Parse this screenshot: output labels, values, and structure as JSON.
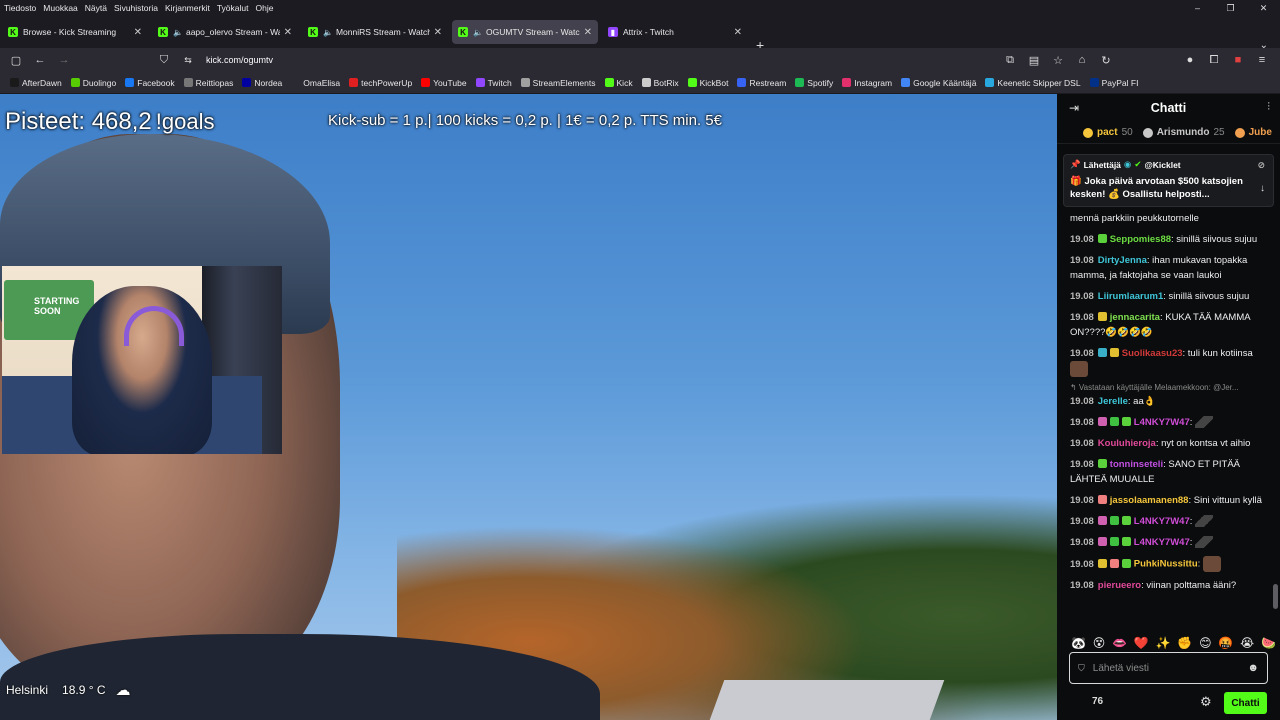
{
  "menubar": {
    "items": [
      "Tiedosto",
      "Muokkaa",
      "Näytä",
      "Sivuhistoria",
      "Kirjanmerkit",
      "Työkalut",
      "Ohje"
    ],
    "window_controls": [
      "–",
      "❐",
      "✕"
    ]
  },
  "tabs": [
    {
      "title": "Browse - Kick Streaming",
      "favicon": "kick",
      "audio": false,
      "active": false
    },
    {
      "title": "aapo_olervo Stream - Watch Live",
      "favicon": "kick",
      "audio": true,
      "active": false
    },
    {
      "title": "MonniRS Stream - Watch Live",
      "favicon": "kick",
      "audio": true,
      "active": false
    },
    {
      "title": "OGUMTV Stream - Watch Live",
      "favicon": "kick",
      "audio": true,
      "active": true
    },
    {
      "title": "Attrix - Twitch",
      "favicon": "twitch",
      "audio": false,
      "active": false
    }
  ],
  "nav": {
    "url": "kick.com/ogumtv",
    "back": "←",
    "forward": "→",
    "sidebar": "▢",
    "shield": "⛉",
    "tune": "⇆"
  },
  "bookmarks": [
    {
      "label": "AfterDawn",
      "color": "#1a1a1a"
    },
    {
      "label": "Duolingo",
      "color": "#58cc02"
    },
    {
      "label": "Facebook",
      "color": "#1877f2"
    },
    {
      "label": "Reittiopas",
      "color": "#777777"
    },
    {
      "label": "Nordea",
      "color": "#0000a0"
    },
    {
      "label": "OmaElisa",
      "color": "#2b2a33"
    },
    {
      "label": "techPowerUp",
      "color": "#e02020"
    },
    {
      "label": "YouTube",
      "color": "#ff0000"
    },
    {
      "label": "Twitch",
      "color": "#9146ff"
    },
    {
      "label": "StreamElements",
      "color": "#a0a0a0"
    },
    {
      "label": "Kick",
      "color": "#53fc18"
    },
    {
      "label": "BotRix",
      "color": "#cccccc"
    },
    {
      "label": "KickBot",
      "color": "#53fc18"
    },
    {
      "label": "Restream",
      "color": "#3763f4"
    },
    {
      "label": "Spotify",
      "color": "#1db954"
    },
    {
      "label": "Instagram",
      "color": "#e1306c"
    },
    {
      "label": "Google Kääntäjä",
      "color": "#4285f4"
    },
    {
      "label": "Keenetic Skipper DSL",
      "color": "#29a8e0"
    },
    {
      "label": "PayPal FI",
      "color": "#003087"
    }
  ],
  "stream": {
    "score_label": "Pisteet: 468,2",
    "goals_cmd": "!goals",
    "rules": "Kick-sub = 1 p.| 100 kicks = 0,2 p. | 1€ = 0,2 p. TTS min. 5€",
    "webcam_poster": "STARTING SOON",
    "weather_city": "Helsinki",
    "weather_temp": "18.9 ° C",
    "weather_icon": "☁"
  },
  "chat": {
    "title": "Chatti",
    "leaderboard": [
      {
        "name": "pact",
        "count": "50",
        "color": "#f5c63c"
      },
      {
        "name": "Arismundo",
        "count": "25",
        "color": "#c8c8c8"
      },
      {
        "name": "Jube",
        "count": "",
        "color": "#f0a050"
      }
    ],
    "pinned": {
      "header": "Lähettäjä",
      "sender": "@Kicklet",
      "text": "🎁 Joka päivä arvotaan $500 katsojien kesken! 💰 Osallistu helposti..."
    },
    "partial_top": "mennä parkkiin peukkutornelle",
    "messages": [
      {
        "ts": "19.08",
        "user": "Seppomies88",
        "color": "#6cde42",
        "text": ": sinillä siivous sujuu",
        "badges": [
          "#5bd13c"
        ]
      },
      {
        "ts": "19.08",
        "user": "DirtyJenna",
        "color": "#3ec6d8",
        "text": ": ihan mukavan topakka mamma, ja faktojaha se vaan laukoi",
        "badges": []
      },
      {
        "ts": "19.08",
        "user": "Liirumlaarum1",
        "color": "#3ec6d8",
        "text": ": sinillä siivous sujuu",
        "badges": []
      },
      {
        "ts": "19.08",
        "user": "jennacarita",
        "color": "#7fe050",
        "text": ": KUKA TÄÄ MAMMA ON????🤣🤣🤣🤣",
        "badges": [
          "#e0c030"
        ]
      },
      {
        "ts": "19.08",
        "user": "Suolikaasu23",
        "color": "#d23a3a",
        "text": ": tuli kun kotiinsa",
        "badges": [
          "#3ab0c8",
          "#e0c030"
        ],
        "emote": true
      },
      {
        "ts": "19.08",
        "user": "Jerelle",
        "color": "#3ec6d8",
        "text": ": aa👌",
        "badges": [],
        "reply": "↰ Vastataan käyttäjälle Melaamekkoon: @Jer..."
      },
      {
        "ts": "19.08",
        "user": "L4NKY7W47",
        "color": "#d04dd8",
        "text": ":",
        "badges": [
          "#d060b0",
          "#40c040",
          "#5bd13c"
        ],
        "gun": true
      },
      {
        "ts": "19.08",
        "user": "Kouluhieroja",
        "color": "#e04a9a",
        "text": ": nyt on kontsa vt aihio",
        "badges": []
      },
      {
        "ts": "19.08",
        "user": "tonninseteli",
        "color": "#c050e0",
        "text": ": SANO ET PITÄÄ LÄHTEÄ MUUALLE",
        "badges": [
          "#5bd13c"
        ]
      },
      {
        "ts": "19.08",
        "user": "jassolaamanen88",
        "color": "#f5c63c",
        "text": ": Sini vittuun kyllä",
        "badges": [
          "#f08080"
        ]
      },
      {
        "ts": "19.08",
        "user": "L4NKY7W47",
        "color": "#d04dd8",
        "text": ":",
        "badges": [
          "#d060b0",
          "#40c040",
          "#5bd13c"
        ],
        "gun": true
      },
      {
        "ts": "19.08",
        "user": "L4NKY7W47",
        "color": "#d04dd8",
        "text": ":",
        "badges": [
          "#d060b0",
          "#40c040",
          "#5bd13c"
        ],
        "gun": true
      },
      {
        "ts": "19.08",
        "user": "PuhkiNussittu",
        "color": "#f5c63c",
        "text": ":",
        "badges": [
          "#e0c030",
          "#f08080",
          "#5bd13c"
        ],
        "emote": true
      },
      {
        "ts": "19.08",
        "user": "pierueero",
        "color": "#e04a9a",
        "text": ": viinan polttama ääni?",
        "badges": []
      }
    ],
    "emote_bar": [
      "🐼",
      "😵",
      "👄",
      "❤️",
      "✨",
      "✊",
      "😊",
      "🤬",
      "😭",
      "🍉"
    ],
    "input_placeholder": "Lähetä viesti",
    "viewer_count": "76",
    "send_label": "Chatti"
  }
}
